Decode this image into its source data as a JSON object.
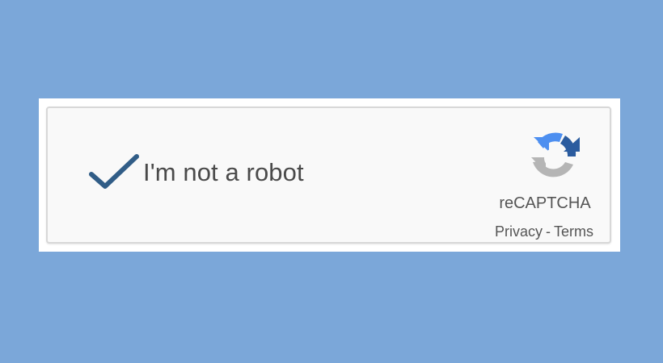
{
  "captcha": {
    "label": "I'm not a robot",
    "brand": "reCAPTCHA",
    "privacy_link": "Privacy",
    "separator": "-",
    "terms_link": "Terms",
    "checked": true,
    "icons": {
      "checkmark": "checkmark-icon",
      "logo": "recaptcha-logo-icon"
    },
    "colors": {
      "background": "#7ba7d9",
      "checkmark": "#315d87",
      "logo_blue_dark": "#2b5c9f",
      "logo_blue": "#4d8ff0",
      "logo_gray": "#b5b5b5"
    }
  }
}
